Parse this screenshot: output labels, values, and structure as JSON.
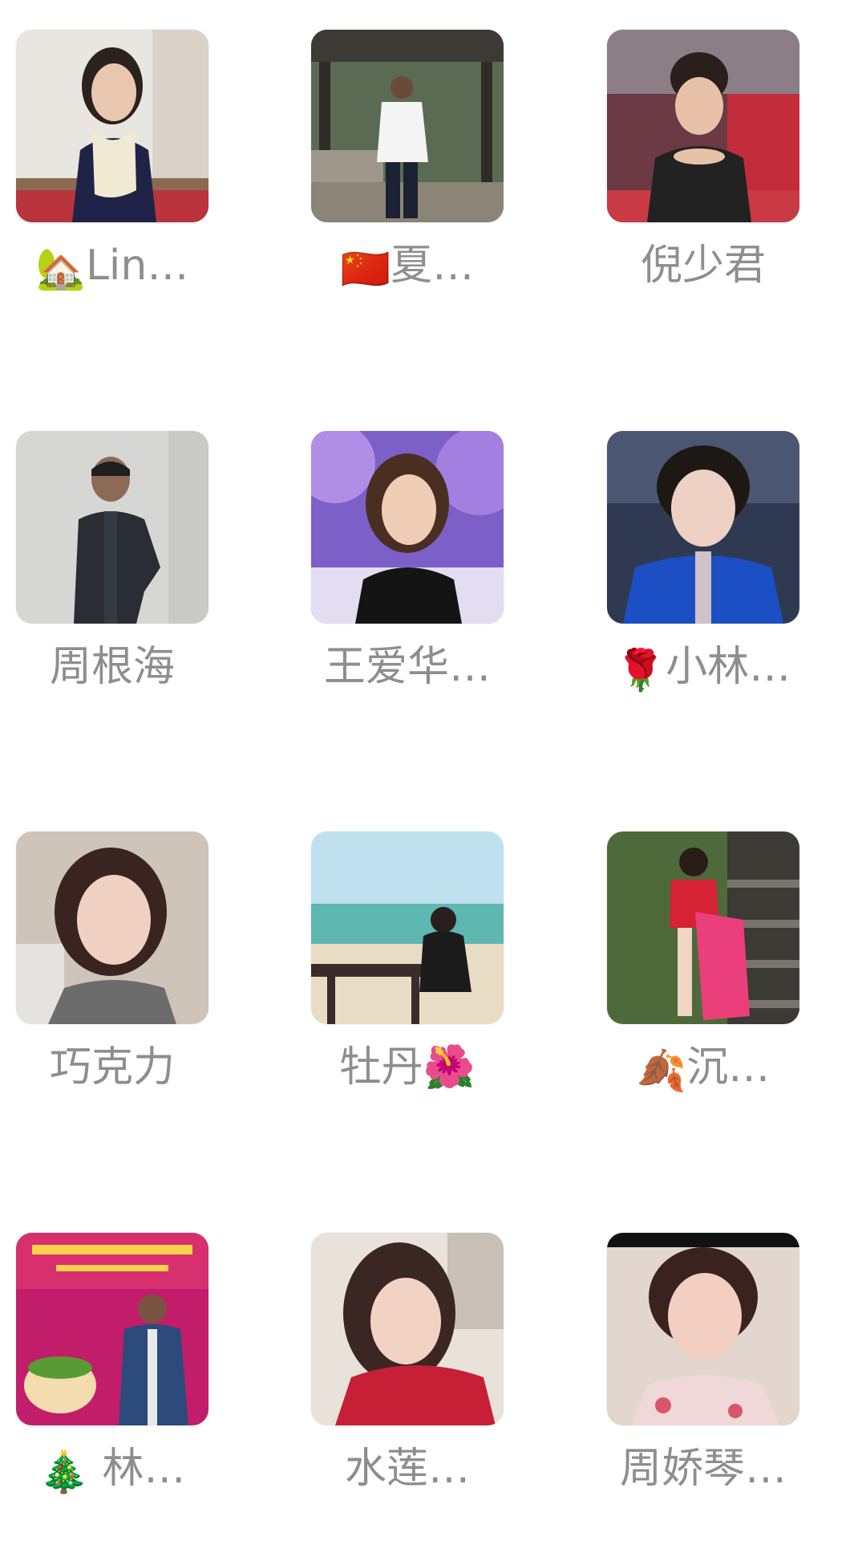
{
  "members": [
    {
      "prefix": "🏡",
      "text": "Lin…",
      "avatar": "avatar-woman-scarf"
    },
    {
      "prefix": "🇨🇳",
      "text": "夏…",
      "avatar": "avatar-man-pavilion"
    },
    {
      "prefix": "",
      "text": "倪少君",
      "avatar": "avatar-woman-banquet"
    },
    {
      "prefix": "",
      "text": "周根海",
      "avatar": "avatar-man-dark-jacket"
    },
    {
      "prefix": "",
      "text": "王爱华…",
      "avatar": "avatar-woman-purple-trees"
    },
    {
      "prefix": "🌹",
      "text": "小林…",
      "avatar": "avatar-woman-blue-jacket"
    },
    {
      "prefix": "",
      "text": "巧克力",
      "avatar": "avatar-woman-selfie"
    },
    {
      "prefix": "",
      "text": "牡丹🌺",
      "avatar": "avatar-woman-beach"
    },
    {
      "prefix": "🍂",
      "text": "沉…",
      "avatar": "avatar-woman-stairs"
    },
    {
      "prefix": "🎄",
      "text": " 林…",
      "avatar": "avatar-man-party-banner"
    },
    {
      "prefix": "",
      "text": "水莲…",
      "avatar": "avatar-woman-red-sweater"
    },
    {
      "prefix": "",
      "text": "周娇琴…",
      "avatar": "avatar-woman-qipao"
    }
  ],
  "colors": {
    "name_text": "#8e8e8e",
    "background": "#ffffff"
  }
}
